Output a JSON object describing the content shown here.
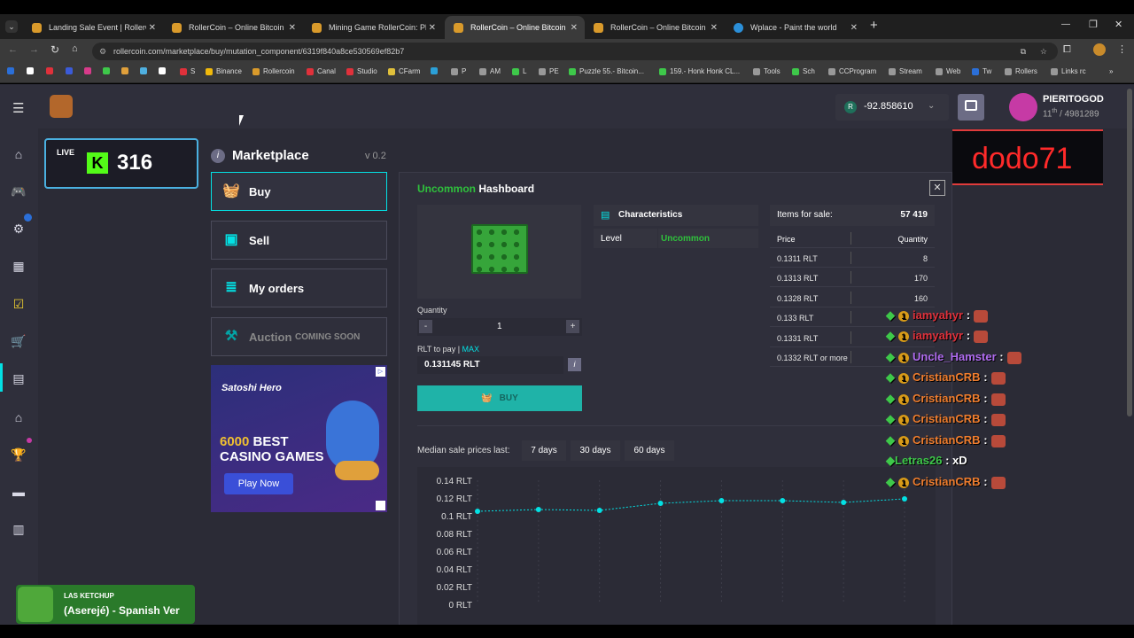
{
  "browser": {
    "tabs": [
      {
        "title": "Landing Sale Event | RollerCoin"
      },
      {
        "title": "RollerCoin – Online Bitcoin Min"
      },
      {
        "title": "Mining Game RollerCoin: Play F"
      },
      {
        "title": "RollerCoin – Online Bitcoin Min"
      },
      {
        "title": "RollerCoin – Online Bitcoin Min"
      },
      {
        "title": "Wplace - Paint the world"
      }
    ],
    "url": "rollercoin.com/marketplace/buy/mutation_component/6319f840a8ce530569ef82b7",
    "bookmarks": [
      "S",
      "Binance",
      "Rollercoin",
      "Canal",
      "Studio",
      "CFarm",
      "P",
      "AM",
      "L",
      "PE",
      "Puzzle 55.- Bitcoin...",
      "159.- Honk Honk CL...",
      "Tools",
      "Sch",
      "CCProgram",
      "Stream",
      "Web",
      "Tw",
      "Rollers",
      "Links rc"
    ]
  },
  "header": {
    "balance": "-92.858610",
    "username": "PIERITOGOD",
    "rank": "11",
    "rank_suffix": "th",
    "rank_total": "/ 4981289"
  },
  "overlay": {
    "live_label": "LIVE",
    "kick_count": "316",
    "streamer": "dodo71",
    "music_artist": "LAS KETCHUP",
    "music_title": "(Aserejé) - Spanish Ver"
  },
  "marketplace": {
    "title": "Marketplace",
    "version": "v 0.2",
    "nav": {
      "buy": "Buy",
      "sell": "Sell",
      "orders": "My orders",
      "auction": "Auction",
      "auction_note": "COMING SOON"
    },
    "ad": {
      "brand": "Satoshi Hero",
      "count": "6000",
      "line1": "BEST",
      "line2": "CASINO GAMES",
      "cta": "Play Now"
    }
  },
  "item": {
    "rarity": "Uncommon",
    "name": "Hashboard",
    "characteristics_title": "Characteristics",
    "level_label": "Level",
    "level_value": "Uncommon",
    "quantity_label": "Quantity",
    "quantity_value": "1",
    "pay_label": "RLT to pay |",
    "max_label": "MAX",
    "pay_value": "0.131145 RLT",
    "buy_label": "BUY"
  },
  "orders": {
    "items_for_sale_label": "Items for sale:",
    "items_for_sale_value": "57 419",
    "price_header": "Price",
    "quantity_header": "Quantity",
    "rows": [
      {
        "price": "0.1311 RLT",
        "qty": "8"
      },
      {
        "price": "0.1313 RLT",
        "qty": "170"
      },
      {
        "price": "0.1328 RLT",
        "qty": "160"
      },
      {
        "price": "0.133 RLT",
        "qty": ""
      },
      {
        "price": "0.1331 RLT",
        "qty": ""
      },
      {
        "price": "0.1332 RLT or more",
        "qty": ""
      }
    ]
  },
  "median": {
    "label": "Median sale prices last:",
    "tabs": [
      "7 days",
      "30 days",
      "60 days"
    ]
  },
  "chart_data": {
    "type": "line",
    "title": "",
    "xlabel": "",
    "ylabel": "",
    "ylim": [
      0,
      0.14
    ],
    "yticks": [
      "0.14 RLT",
      "0.12 RLT",
      "0.1 RLT",
      "0.08 RLT",
      "0.06 RLT",
      "0.04 RLT",
      "0.02 RLT",
      "0 RLT"
    ],
    "y": [
      0.105,
      0.107,
      0.106,
      0.114,
      0.117,
      0.117,
      0.115,
      0.119
    ],
    "color": "#03e1e4"
  },
  "chat": [
    {
      "user": "iamyahyr",
      "msg": ":",
      "color": "#e0313b"
    },
    {
      "user": "iamyahyr",
      "msg": ":",
      "color": "#e0313b"
    },
    {
      "user": "Uncle_Hamster",
      "msg": ":",
      "color": "#b06cf0"
    },
    {
      "user": "CristianCRB",
      "msg": ":",
      "color": "#ef7d2e"
    },
    {
      "user": "CristianCRB",
      "msg": ":",
      "color": "#ef7d2e"
    },
    {
      "user": "CristianCRB",
      "msg": ":",
      "color": "#ef7d2e"
    },
    {
      "user": "CristianCRB",
      "msg": ":",
      "color": "#ef7d2e"
    },
    {
      "user": "Letras26",
      "msg": ": xD",
      "color": "#3ec84a"
    },
    {
      "user": "CristianCRB",
      "msg": ":",
      "color": "#ef7d2e"
    }
  ],
  "colors": {
    "accent": "#03e1e4",
    "uncommon": "#2fc13c",
    "panel": "#2f2f3b",
    "background": "#2b2b36"
  }
}
